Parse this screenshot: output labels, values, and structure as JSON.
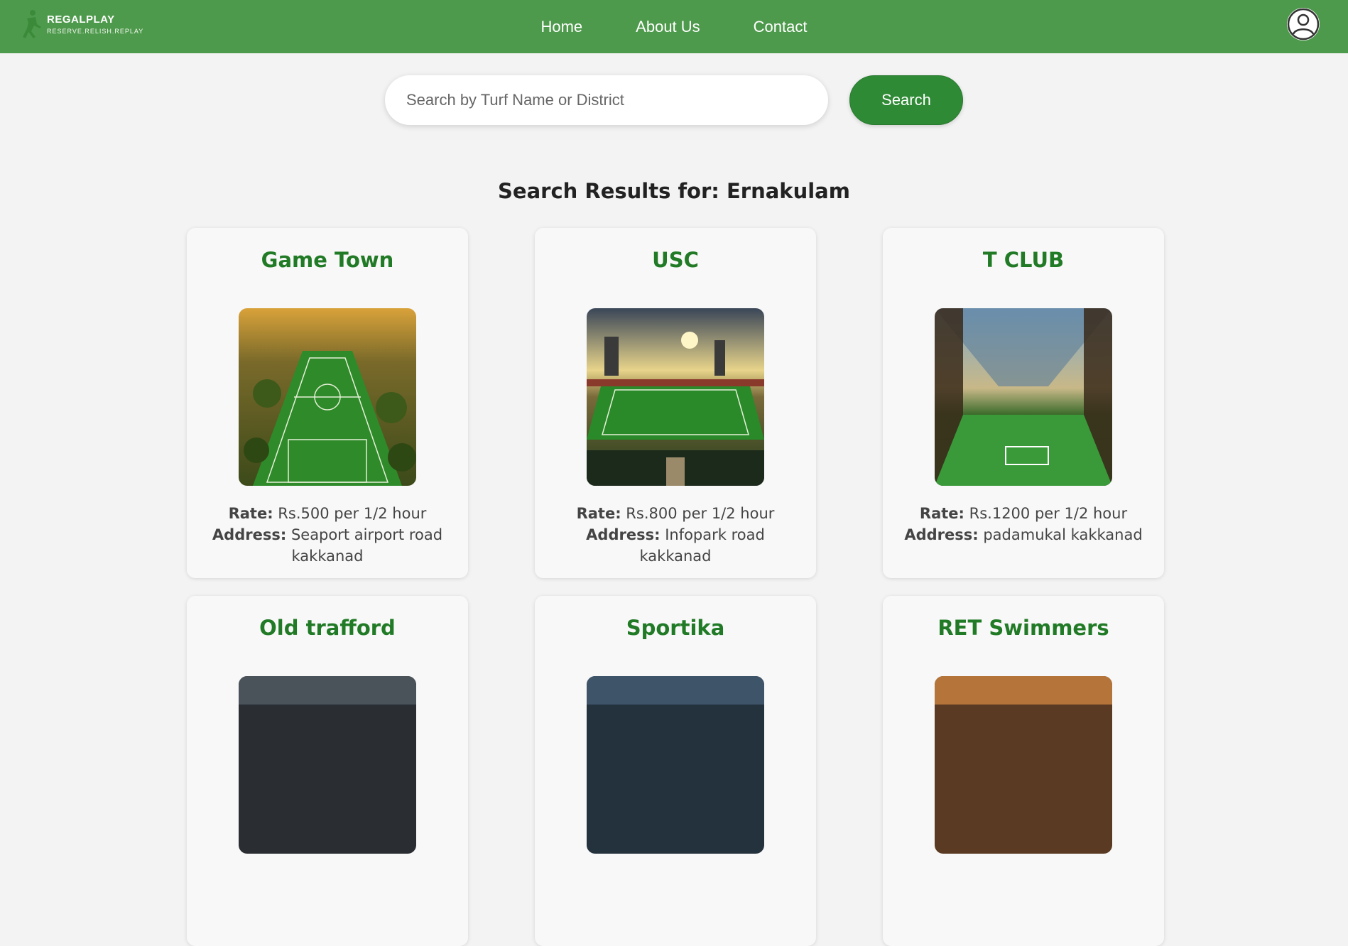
{
  "brand": {
    "name": "REGALPLAY",
    "tagline": "RESERVE.RELISH.REPLAY"
  },
  "nav": {
    "links": [
      "Home",
      "About Us",
      "Contact"
    ]
  },
  "search": {
    "placeholder": "Search by Turf Name or District",
    "value": "",
    "button_label": "Search"
  },
  "results": {
    "heading": "Search Results for: Ernakulam",
    "rate_label": "Rate:",
    "address_label": "Address:",
    "cards": [
      {
        "name": "Game Town",
        "rate": "Rs.500 per 1/2 hour",
        "address": "Seaport airport road kakkanad",
        "image": "aerial-football-field"
      },
      {
        "name": "USC",
        "rate": "Rs.800 per 1/2 hour",
        "address": "Infopark road kakkanad",
        "image": "stadium-sunset"
      },
      {
        "name": "T CLUB",
        "rate": "Rs.1200 per 1/2 hour",
        "address": "padamukal kakkanad",
        "image": "indoor-arena"
      },
      {
        "name": "Old trafford",
        "rate": "",
        "address": "",
        "image": "indoor-arena-dark"
      },
      {
        "name": "Sportika",
        "rate": "",
        "address": "",
        "image": "indoor-hall"
      },
      {
        "name": "RET Swimmers",
        "rate": "",
        "address": "",
        "image": "swimming-hall"
      }
    ]
  },
  "colors": {
    "header_bg": "#4e9a4c",
    "accent": "#2f8a35",
    "card_title": "#217a26",
    "page_bg": "#f3f3f3"
  }
}
